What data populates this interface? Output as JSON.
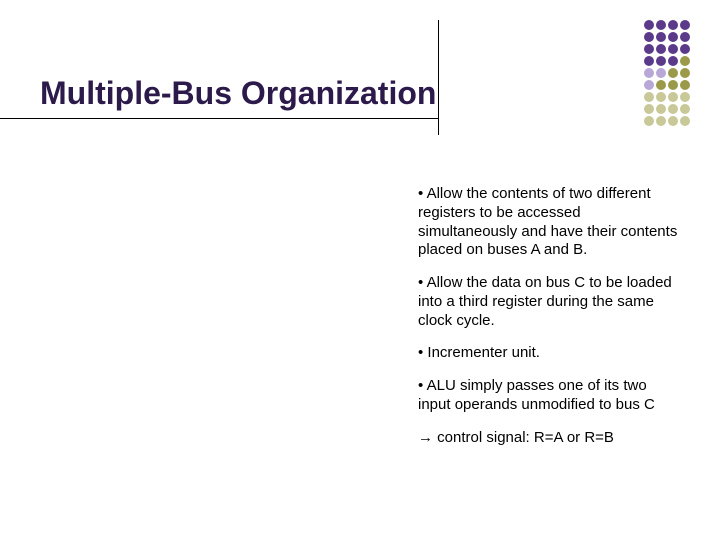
{
  "title": "Multiple-Bus Organization",
  "bullets": {
    "b1": "• Allow the contents of two different registers to be accessed simultaneously and have their contents placed on buses A and B.",
    "b2": "• Allow the data on bus C to be loaded into a third register during the same clock cycle.",
    "b3": "• Incrementer unit.",
    "b4": "• ALU simply passes one of its two input operands unmodified to bus C",
    "b5": "→ control signal: R=A or R=B"
  }
}
